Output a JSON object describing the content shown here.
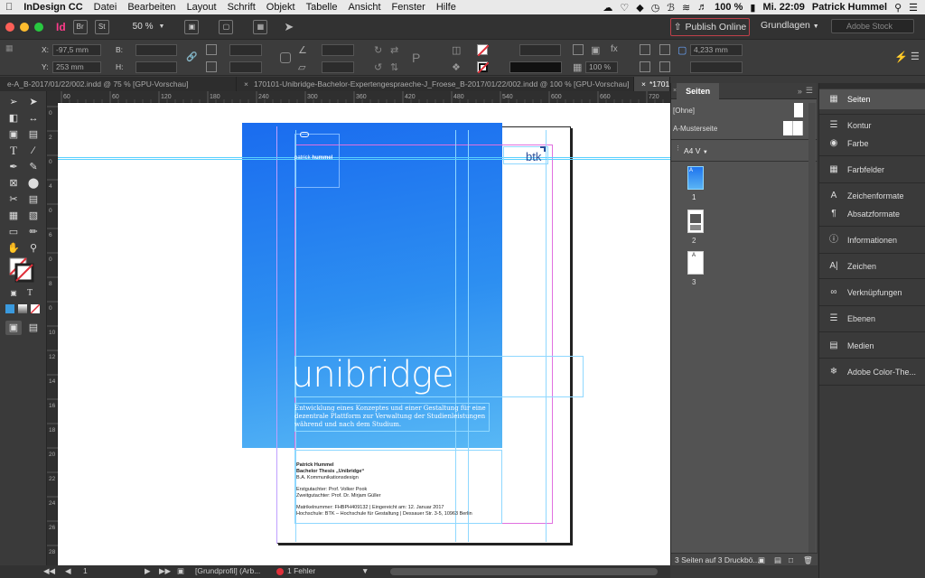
{
  "menubar": {
    "apple": "",
    "app": "InDesign CC",
    "items": [
      "Datei",
      "Bearbeiten",
      "Layout",
      "Schrift",
      "Objekt",
      "Tabelle",
      "Ansicht",
      "Fenster",
      "Hilfe"
    ],
    "battery": "100 %",
    "clock": "Mi. 22:09",
    "user": "Patrick Hummel"
  },
  "appbar": {
    "app_icon": "Id",
    "bridge": "Br",
    "stock": "St",
    "zoom": "50 %",
    "publish_label": "Publish Online",
    "workspace": "Grundlagen",
    "stock_search_placeholder": "Adobe Stock"
  },
  "control": {
    "x_label": "X:",
    "x_value": "-97,5 mm",
    "y_label": "Y:",
    "y_value": "253 mm",
    "w_label": "B:",
    "h_label": "H:",
    "stroke_weight": "4,233 mm",
    "opacity": "100 %"
  },
  "tabs": [
    {
      "label": "e-A_B-2017/01/22/002.indd @ 75 % [GPU-Vorschau]",
      "active": false
    },
    {
      "label": "170101-Unibridge-Bachelor-Expertengespraeche-J_Froese_B-2017/01/22/002.indd @ 100 % [GPU-Vorschau]",
      "active": false
    },
    {
      "label": "*1701",
      "active": true
    }
  ],
  "ruler": {
    "h_ticks": [
      "60",
      "60",
      "120",
      "180",
      "240",
      "300",
      "360",
      "420",
      "480",
      "540",
      "600",
      "660",
      "720"
    ],
    "v_ticks": [
      "0",
      "2",
      "0",
      "4",
      "0",
      "6",
      "0",
      "8",
      "0",
      "1 0",
      "1 2",
      "1 4",
      "1 6",
      "1 8",
      "2 0",
      "2 2",
      "2 4",
      "2 6",
      "2 8"
    ]
  },
  "document": {
    "logo_text_left": "patrick",
    "logo_text_right": "hummel",
    "btk": "btk",
    "title": "unibridge",
    "subtitle_line1": "Entwicklung eines Konzeptes und einer Gestaltung für eine",
    "subtitle_line2": "dezentrale Plattform zur Verwaltung der Studienleistungen",
    "subtitle_line3": "während und nach dem Studium.",
    "author": "Patrick Hummel",
    "thesis": "Bachelor Thesis „Unibridge“",
    "program": "B.A. Kommunikationsdesign",
    "reviewer1": "Erstgutachter:     Prof. Volker Pook",
    "reviewer2": "Zweitgutachter:    Prof. Dr. Mirjam Güller",
    "matrikel": "Matrikelnummer: FHBPH409132 | Eingereicht am: 12. Januar 2017",
    "school": "Hochschule: BTK – Hochschule für Gestaltung | Dessauer Str. 3-5, 10963 Berlin"
  },
  "statusbar": {
    "page": "1",
    "profile": "[Grundprofil] (Arb...",
    "errors": "1 Fehler"
  },
  "pages_panel": {
    "tab_label": "Seiten",
    "none": "[Ohne]",
    "master": "A-Musterseite",
    "size": "A4 V",
    "pages": [
      "1",
      "2",
      "3"
    ],
    "footer": "3 Seiten auf 3 Druckbö..."
  },
  "dock": {
    "items": [
      {
        "label": "Seiten",
        "icon": "pages-icon",
        "active": true
      },
      {
        "label": "Kontur",
        "icon": "stroke-icon",
        "active": false
      },
      {
        "label": "Farbe",
        "icon": "color-icon",
        "active": false
      },
      {
        "label": "Farbfelder",
        "icon": "swatches-icon",
        "active": false
      },
      {
        "label": "Zeichenformate",
        "icon": "character-styles-icon",
        "active": false
      },
      {
        "label": "Absatzformate",
        "icon": "paragraph-styles-icon",
        "active": false
      },
      {
        "label": "Informationen",
        "icon": "info-icon",
        "active": false
      },
      {
        "label": "Zeichen",
        "icon": "character-icon",
        "active": false
      },
      {
        "label": "Verknüpfungen",
        "icon": "links-icon",
        "active": false
      },
      {
        "label": "Ebenen",
        "icon": "layers-icon",
        "active": false
      },
      {
        "label": "Medien",
        "icon": "media-icon",
        "active": false
      },
      {
        "label": "Adobe Color-The...",
        "icon": "adobe-color-icon",
        "active": false
      }
    ]
  },
  "colors": {
    "gradient_top": "#1e74ee",
    "gradient_bottom": "#4fb4f4",
    "publish_border": "#c0404a",
    "guide_cyan": "#5ad0ff",
    "margin_magenta": "#e070e0"
  }
}
